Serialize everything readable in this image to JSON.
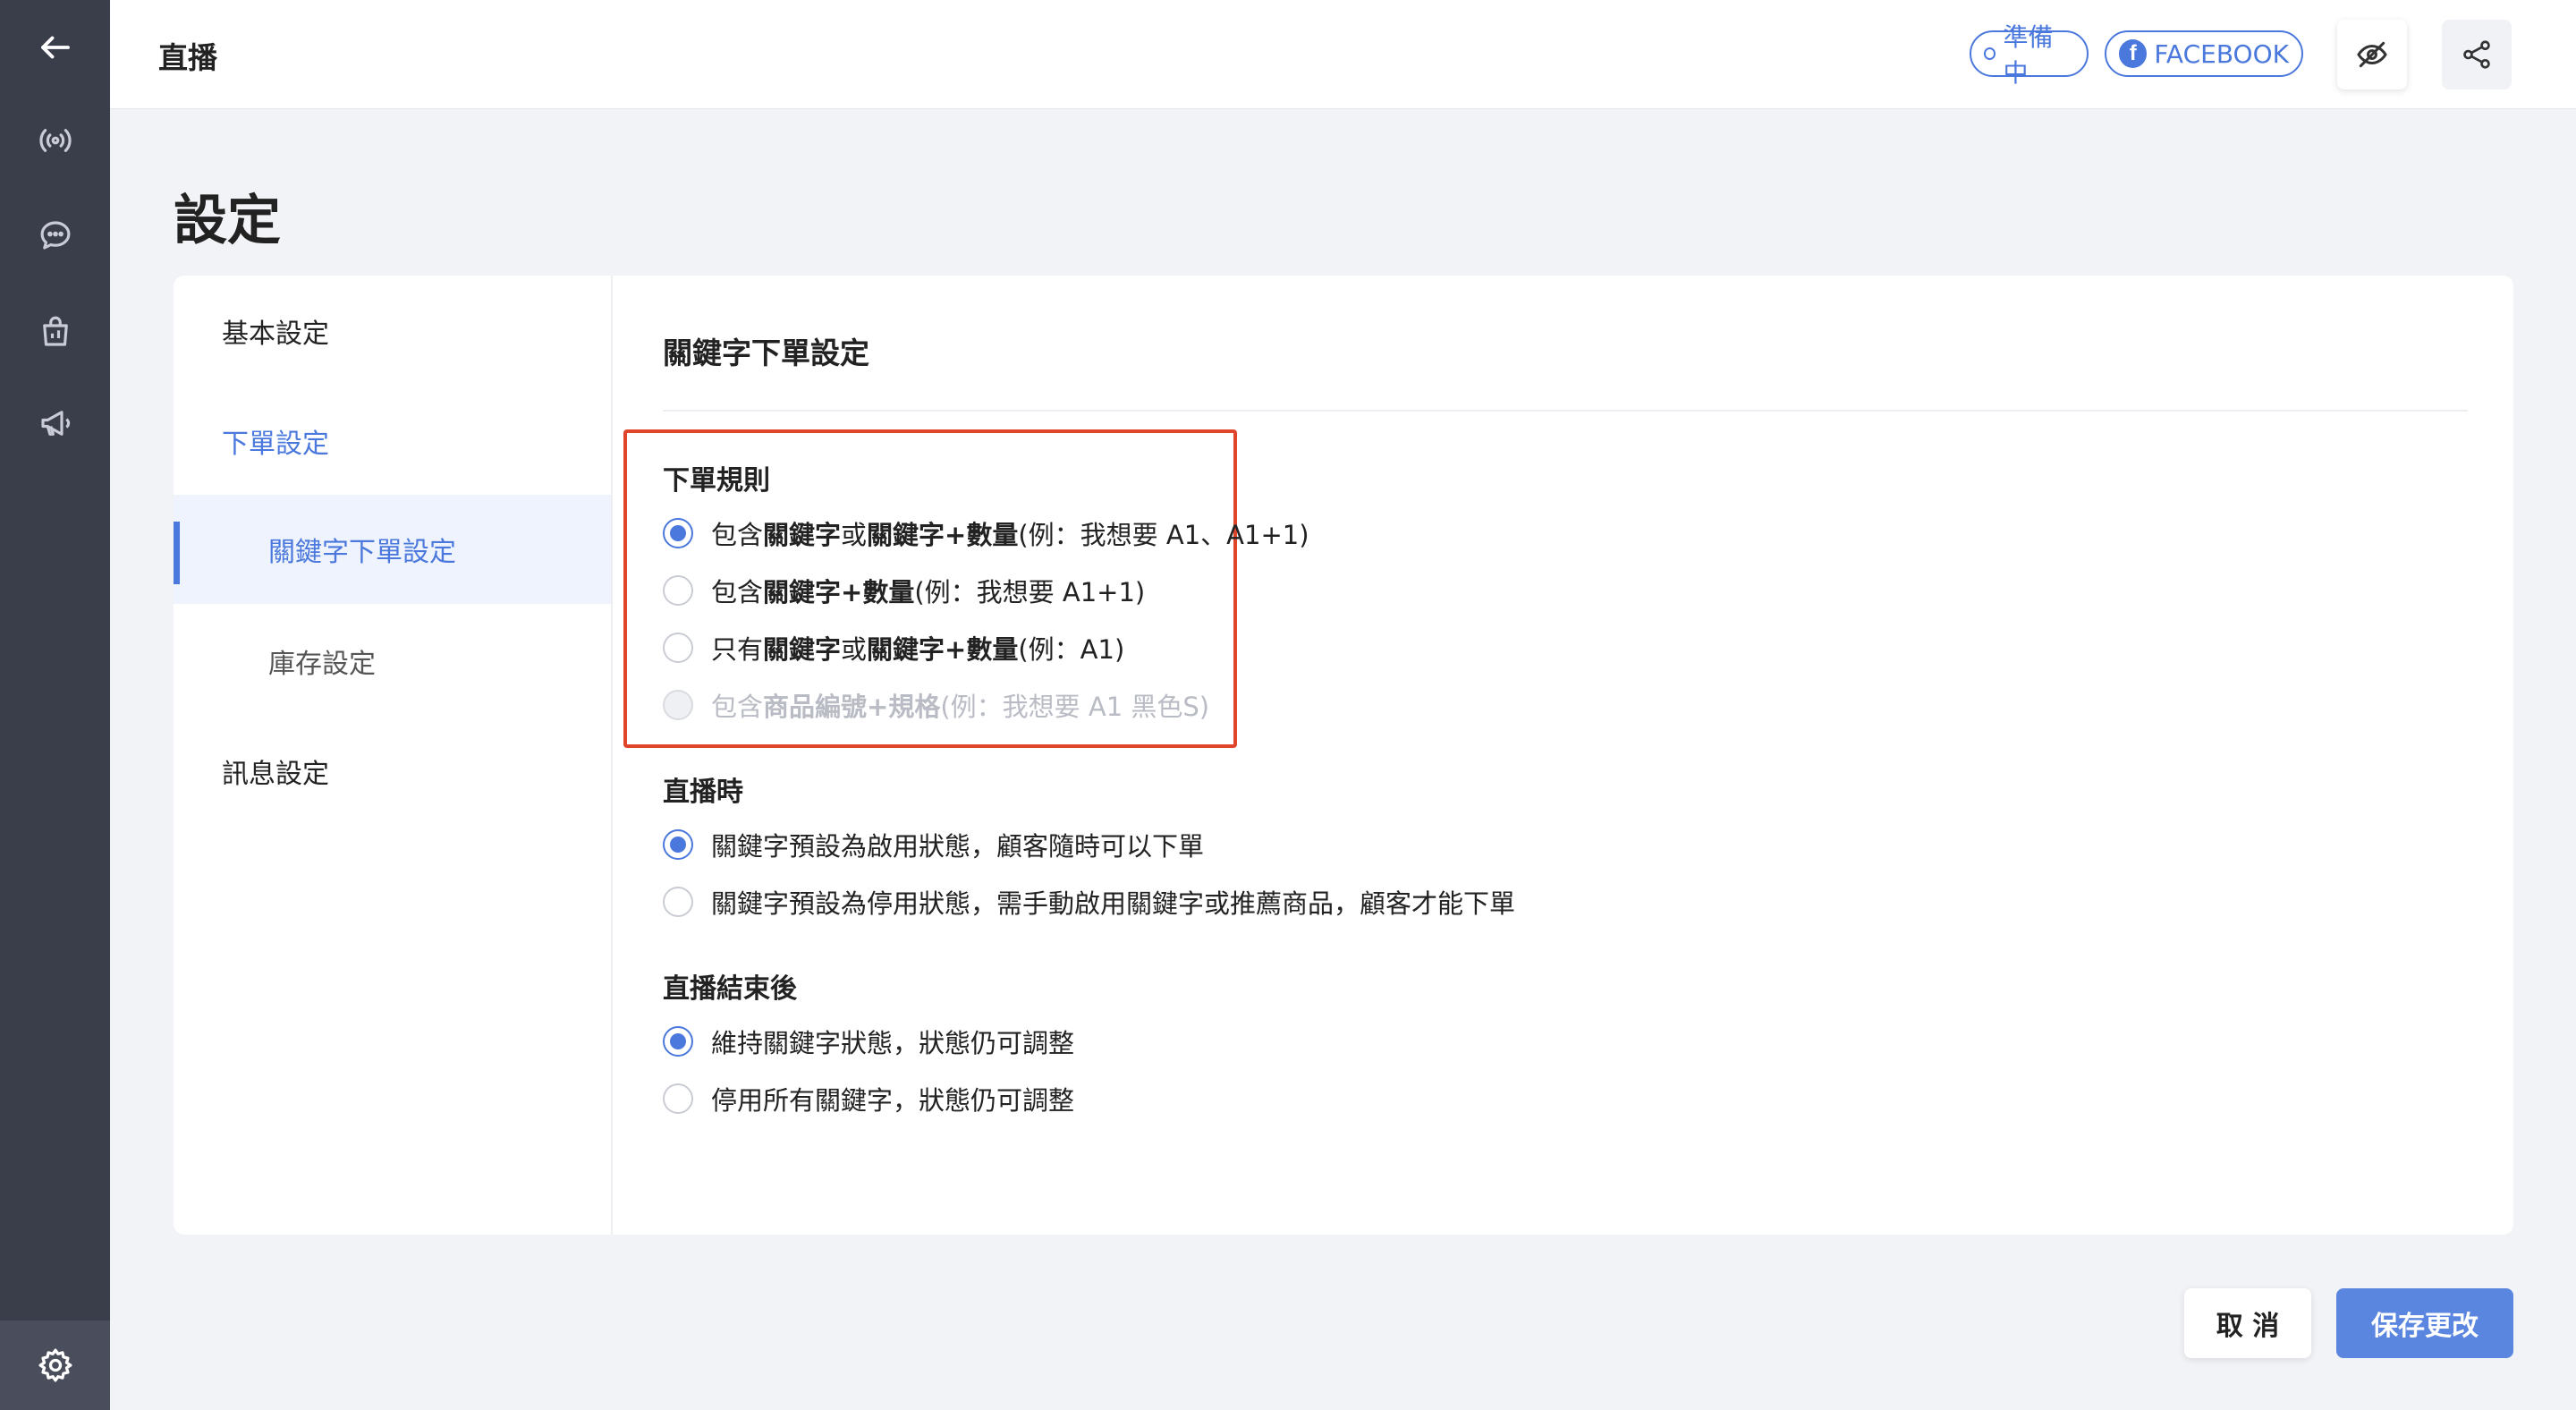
{
  "header": {
    "title": "直播",
    "status_pill": "準備中",
    "platform_pill": "FACEBOOK"
  },
  "rail": {
    "icons": [
      "arrow-left-icon",
      "broadcast-icon",
      "chat-icon",
      "shopping-bag-icon",
      "megaphone-icon",
      "gear-icon"
    ]
  },
  "page": {
    "title": "設定"
  },
  "sidebar": {
    "items": [
      {
        "label": "基本設定"
      },
      {
        "label": "下單設定"
      },
      {
        "label": "關鍵字下單設定"
      },
      {
        "label": "庫存設定"
      },
      {
        "label": "訊息設定"
      }
    ]
  },
  "content": {
    "title": "關鍵字下單設定",
    "order_rules": {
      "label": "下單規則",
      "options": [
        {
          "p1": "包含 ",
          "b1": "關鍵字",
          "p2": " 或 ",
          "b2": "關鍵字+數量",
          "p3": " (例：我想要 A1、A1+1)",
          "checked": true
        },
        {
          "p1": "包含 ",
          "b1": "關鍵字+數量",
          "p2": " (例：我想要 A1+1)",
          "checked": false
        },
        {
          "p1": "只有 ",
          "b1": "關鍵字",
          "p2": " 或 ",
          "b2": "關鍵字+數量",
          "p3": " (例：A1)",
          "checked": false
        },
        {
          "p1": "包含 ",
          "b1": "商品編號+規格",
          "p2": " (例：我想要 A1 黑色S)",
          "checked": false,
          "disabled": true
        }
      ]
    },
    "during_live": {
      "label": "直播時",
      "options": [
        {
          "text": "關鍵字預設為啟用狀態，顧客隨時可以下單",
          "checked": true
        },
        {
          "text": "關鍵字預設為停用狀態，需手動啟用關鍵字或推薦商品，顧客才能下單",
          "checked": false
        }
      ]
    },
    "after_live": {
      "label": "直播結束後",
      "options": [
        {
          "text": "維持關鍵字狀態，狀態仍可調整",
          "checked": true
        },
        {
          "text": "停用所有關鍵字，狀態仍可調整",
          "checked": false
        }
      ]
    }
  },
  "footer": {
    "cancel_label": "取 消",
    "save_label": "保存更改"
  },
  "colors": {
    "accent": "#4a78dc",
    "rail": "#3a3d4a",
    "highlight": "#e0452b",
    "save_button": "#5a86e0"
  }
}
